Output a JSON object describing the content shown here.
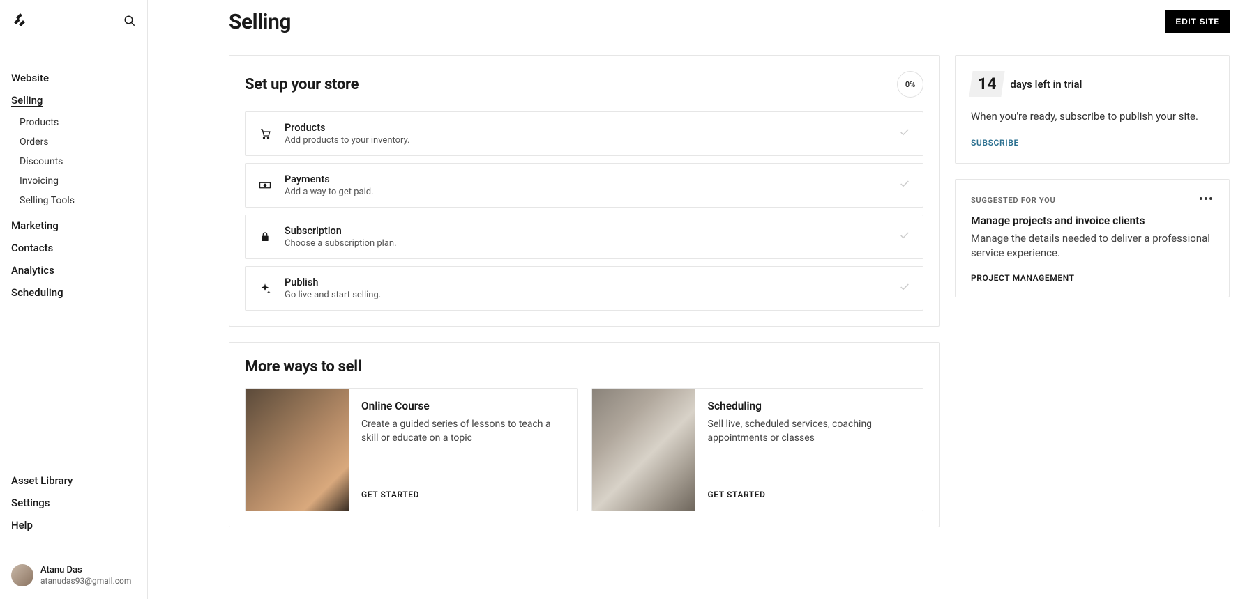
{
  "sidebar": {
    "nav": {
      "website": "Website",
      "selling": "Selling",
      "marketing": "Marketing",
      "contacts": "Contacts",
      "analytics": "Analytics",
      "scheduling": "Scheduling"
    },
    "selling_sub": {
      "products": "Products",
      "orders": "Orders",
      "discounts": "Discounts",
      "invoicing": "Invoicing",
      "selling_tools": "Selling Tools"
    },
    "bottom": {
      "asset_library": "Asset Library",
      "settings": "Settings",
      "help": "Help"
    },
    "user": {
      "name": "Atanu Das",
      "email": "atanudas93@gmail.com"
    }
  },
  "header": {
    "title": "Selling",
    "edit_site": "EDIT SITE"
  },
  "setup": {
    "title": "Set up your store",
    "progress": "0%",
    "steps": [
      {
        "title": "Products",
        "desc": "Add products to your inventory."
      },
      {
        "title": "Payments",
        "desc": "Add a way to get paid."
      },
      {
        "title": "Subscription",
        "desc": "Choose a subscription plan."
      },
      {
        "title": "Publish",
        "desc": "Go live and start selling."
      }
    ]
  },
  "more_ways": {
    "title": "More ways to sell",
    "cards": [
      {
        "title": "Online Course",
        "desc": "Create a guided series of lessons to teach a skill or educate on a topic",
        "cta": "GET STARTED"
      },
      {
        "title": "Scheduling",
        "desc": "Sell live, scheduled services, coaching appointments or classes",
        "cta": "GET STARTED"
      }
    ]
  },
  "trial": {
    "days": "14",
    "label": "days left in trial",
    "desc": "When you're ready, subscribe to publish your site.",
    "cta": "SUBSCRIBE"
  },
  "suggested": {
    "label": "SUGGESTED FOR YOU",
    "title": "Manage projects and invoice clients",
    "desc": "Manage the details needed to deliver a professional service experience.",
    "cta": "PROJECT MANAGEMENT"
  }
}
